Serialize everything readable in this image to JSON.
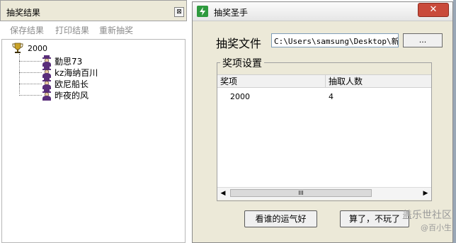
{
  "left_panel": {
    "title": "抽奖结果",
    "close_symbol": "⊠",
    "toolbar": [
      "保存结果",
      "打印结果",
      "重新抽奖"
    ],
    "tree": {
      "root_label": "2000",
      "root_icon": "trophy-icon",
      "items": [
        "勤思73",
        "kz海纳百川",
        "欧尼船长",
        "昨夜的风"
      ],
      "item_icon": "person-icon"
    }
  },
  "window": {
    "title": "抽奖圣手",
    "close_symbol": "✕",
    "file_label": "抽奖文件",
    "file_path": "C:\\Users\\samsung\\Desktop\\新建",
    "browse_label": "...",
    "group_label": "奖项设置",
    "table": {
      "headers": [
        "奖项",
        "抽取人数"
      ],
      "rows": [
        [
          "2000",
          "4"
        ]
      ]
    },
    "scrollbar_thumb_glyph": "III",
    "buttons": {
      "luck": "看谁的运气好",
      "quit": "算了，不玩了"
    }
  },
  "watermark": {
    "line1": "盖乐世社区",
    "line2": "@百小生"
  }
}
